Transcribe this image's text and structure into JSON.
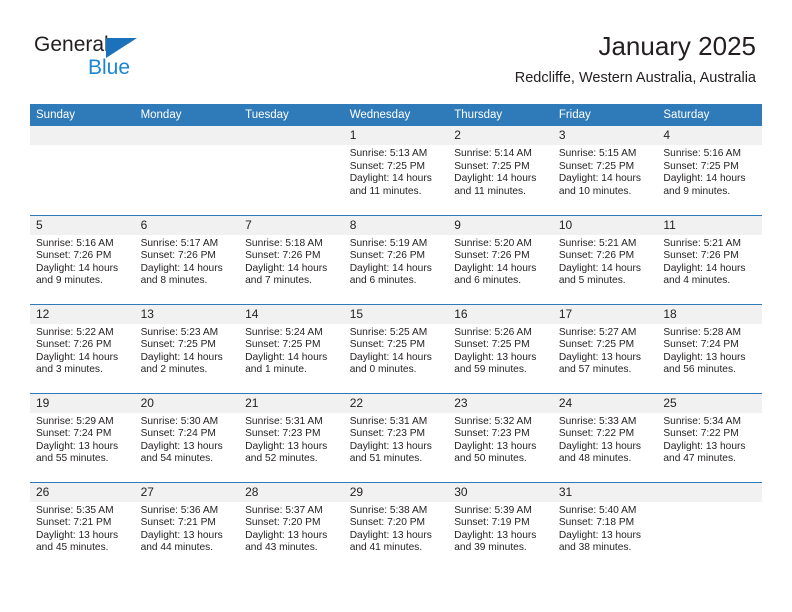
{
  "brand": {
    "name_part1": "General",
    "name_part2": "Blue",
    "accent_color": "#1c86d4",
    "triangle_color": "#1c72ba"
  },
  "header": {
    "title": "January 2025",
    "subtitle": "Redcliffe, Western Australia, Australia"
  },
  "calendar": {
    "header_bg": "#2f7ab8",
    "daynum_bg": "#f1f1f1",
    "weekday_headers": [
      "Sunday",
      "Monday",
      "Tuesday",
      "Wednesday",
      "Thursday",
      "Friday",
      "Saturday"
    ],
    "weeks": [
      [
        {
          "day": "",
          "blank": true
        },
        {
          "day": "",
          "blank": true
        },
        {
          "day": "",
          "blank": true
        },
        {
          "day": "1",
          "sunrise": "Sunrise: 5:13 AM",
          "sunset": "Sunset: 7:25 PM",
          "daylight_line1": "Daylight: 14 hours",
          "daylight_line2": "and 11 minutes."
        },
        {
          "day": "2",
          "sunrise": "Sunrise: 5:14 AM",
          "sunset": "Sunset: 7:25 PM",
          "daylight_line1": "Daylight: 14 hours",
          "daylight_line2": "and 11 minutes."
        },
        {
          "day": "3",
          "sunrise": "Sunrise: 5:15 AM",
          "sunset": "Sunset: 7:25 PM",
          "daylight_line1": "Daylight: 14 hours",
          "daylight_line2": "and 10 minutes."
        },
        {
          "day": "4",
          "sunrise": "Sunrise: 5:16 AM",
          "sunset": "Sunset: 7:25 PM",
          "daylight_line1": "Daylight: 14 hours",
          "daylight_line2": "and 9 minutes."
        }
      ],
      [
        {
          "day": "5",
          "sunrise": "Sunrise: 5:16 AM",
          "sunset": "Sunset: 7:26 PM",
          "daylight_line1": "Daylight: 14 hours",
          "daylight_line2": "and 9 minutes."
        },
        {
          "day": "6",
          "sunrise": "Sunrise: 5:17 AM",
          "sunset": "Sunset: 7:26 PM",
          "daylight_line1": "Daylight: 14 hours",
          "daylight_line2": "and 8 minutes."
        },
        {
          "day": "7",
          "sunrise": "Sunrise: 5:18 AM",
          "sunset": "Sunset: 7:26 PM",
          "daylight_line1": "Daylight: 14 hours",
          "daylight_line2": "and 7 minutes."
        },
        {
          "day": "8",
          "sunrise": "Sunrise: 5:19 AM",
          "sunset": "Sunset: 7:26 PM",
          "daylight_line1": "Daylight: 14 hours",
          "daylight_line2": "and 6 minutes."
        },
        {
          "day": "9",
          "sunrise": "Sunrise: 5:20 AM",
          "sunset": "Sunset: 7:26 PM",
          "daylight_line1": "Daylight: 14 hours",
          "daylight_line2": "and 6 minutes."
        },
        {
          "day": "10",
          "sunrise": "Sunrise: 5:21 AM",
          "sunset": "Sunset: 7:26 PM",
          "daylight_line1": "Daylight: 14 hours",
          "daylight_line2": "and 5 minutes."
        },
        {
          "day": "11",
          "sunrise": "Sunrise: 5:21 AM",
          "sunset": "Sunset: 7:26 PM",
          "daylight_line1": "Daylight: 14 hours",
          "daylight_line2": "and 4 minutes."
        }
      ],
      [
        {
          "day": "12",
          "sunrise": "Sunrise: 5:22 AM",
          "sunset": "Sunset: 7:26 PM",
          "daylight_line1": "Daylight: 14 hours",
          "daylight_line2": "and 3 minutes."
        },
        {
          "day": "13",
          "sunrise": "Sunrise: 5:23 AM",
          "sunset": "Sunset: 7:25 PM",
          "daylight_line1": "Daylight: 14 hours",
          "daylight_line2": "and 2 minutes."
        },
        {
          "day": "14",
          "sunrise": "Sunrise: 5:24 AM",
          "sunset": "Sunset: 7:25 PM",
          "daylight_line1": "Daylight: 14 hours",
          "daylight_line2": "and 1 minute."
        },
        {
          "day": "15",
          "sunrise": "Sunrise: 5:25 AM",
          "sunset": "Sunset: 7:25 PM",
          "daylight_line1": "Daylight: 14 hours",
          "daylight_line2": "and 0 minutes."
        },
        {
          "day": "16",
          "sunrise": "Sunrise: 5:26 AM",
          "sunset": "Sunset: 7:25 PM",
          "daylight_line1": "Daylight: 13 hours",
          "daylight_line2": "and 59 minutes."
        },
        {
          "day": "17",
          "sunrise": "Sunrise: 5:27 AM",
          "sunset": "Sunset: 7:25 PM",
          "daylight_line1": "Daylight: 13 hours",
          "daylight_line2": "and 57 minutes."
        },
        {
          "day": "18",
          "sunrise": "Sunrise: 5:28 AM",
          "sunset": "Sunset: 7:24 PM",
          "daylight_line1": "Daylight: 13 hours",
          "daylight_line2": "and 56 minutes."
        }
      ],
      [
        {
          "day": "19",
          "sunrise": "Sunrise: 5:29 AM",
          "sunset": "Sunset: 7:24 PM",
          "daylight_line1": "Daylight: 13 hours",
          "daylight_line2": "and 55 minutes."
        },
        {
          "day": "20",
          "sunrise": "Sunrise: 5:30 AM",
          "sunset": "Sunset: 7:24 PM",
          "daylight_line1": "Daylight: 13 hours",
          "daylight_line2": "and 54 minutes."
        },
        {
          "day": "21",
          "sunrise": "Sunrise: 5:31 AM",
          "sunset": "Sunset: 7:23 PM",
          "daylight_line1": "Daylight: 13 hours",
          "daylight_line2": "and 52 minutes."
        },
        {
          "day": "22",
          "sunrise": "Sunrise: 5:31 AM",
          "sunset": "Sunset: 7:23 PM",
          "daylight_line1": "Daylight: 13 hours",
          "daylight_line2": "and 51 minutes."
        },
        {
          "day": "23",
          "sunrise": "Sunrise: 5:32 AM",
          "sunset": "Sunset: 7:23 PM",
          "daylight_line1": "Daylight: 13 hours",
          "daylight_line2": "and 50 minutes."
        },
        {
          "day": "24",
          "sunrise": "Sunrise: 5:33 AM",
          "sunset": "Sunset: 7:22 PM",
          "daylight_line1": "Daylight: 13 hours",
          "daylight_line2": "and 48 minutes."
        },
        {
          "day": "25",
          "sunrise": "Sunrise: 5:34 AM",
          "sunset": "Sunset: 7:22 PM",
          "daylight_line1": "Daylight: 13 hours",
          "daylight_line2": "and 47 minutes."
        }
      ],
      [
        {
          "day": "26",
          "sunrise": "Sunrise: 5:35 AM",
          "sunset": "Sunset: 7:21 PM",
          "daylight_line1": "Daylight: 13 hours",
          "daylight_line2": "and 45 minutes."
        },
        {
          "day": "27",
          "sunrise": "Sunrise: 5:36 AM",
          "sunset": "Sunset: 7:21 PM",
          "daylight_line1": "Daylight: 13 hours",
          "daylight_line2": "and 44 minutes."
        },
        {
          "day": "28",
          "sunrise": "Sunrise: 5:37 AM",
          "sunset": "Sunset: 7:20 PM",
          "daylight_line1": "Daylight: 13 hours",
          "daylight_line2": "and 43 minutes."
        },
        {
          "day": "29",
          "sunrise": "Sunrise: 5:38 AM",
          "sunset": "Sunset: 7:20 PM",
          "daylight_line1": "Daylight: 13 hours",
          "daylight_line2": "and 41 minutes."
        },
        {
          "day": "30",
          "sunrise": "Sunrise: 5:39 AM",
          "sunset": "Sunset: 7:19 PM",
          "daylight_line1": "Daylight: 13 hours",
          "daylight_line2": "and 39 minutes."
        },
        {
          "day": "31",
          "sunrise": "Sunrise: 5:40 AM",
          "sunset": "Sunset: 7:18 PM",
          "daylight_line1": "Daylight: 13 hours",
          "daylight_line2": "and 38 minutes."
        },
        {
          "day": "",
          "blank": true
        }
      ]
    ]
  }
}
